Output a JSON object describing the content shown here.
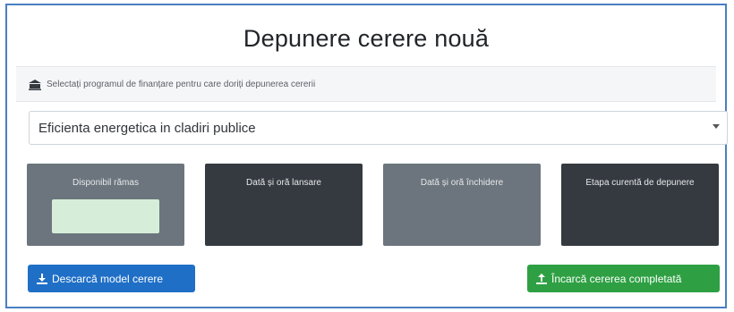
{
  "page": {
    "title": "Depunere cerere nouă",
    "section_header": "Selectați programul de finanțare pentru care doriți depunerea cererii",
    "section_icon": "bank-icon"
  },
  "program_select": {
    "selected": "Eficienta energetica in cladiri publice",
    "arrow_icon": "dropdown-caret-icon"
  },
  "cards": [
    {
      "label": "Disponibil rămas",
      "color": "#6c757d"
    },
    {
      "label": "Dată și oră lansare",
      "color": "#343a40"
    },
    {
      "label": "Dată și oră închidere",
      "color": "#6c757d"
    },
    {
      "label": "Etapa curentă de depunere",
      "color": "#343a40"
    }
  ],
  "buttons": {
    "download_label": "Descarcă model cerere",
    "download_icon": "download-icon",
    "download_color": "#1f6fc6",
    "upload_label": "Încarcă cererea completată",
    "upload_icon": "upload-icon",
    "upload_color": "#2ea043"
  }
}
